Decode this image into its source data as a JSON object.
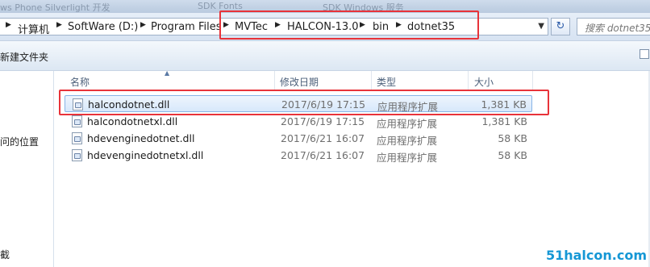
{
  "top_strip": {
    "blur_1": "ws Phone Silverlight 开发",
    "blur_2": "SDK Fonts",
    "blur_3": "SDK Windows 服务"
  },
  "address_bar": {
    "breadcrumbs": [
      "计算机",
      "SoftWare (D:)",
      "Program Files",
      "MVTec",
      "HALCON-13.0",
      "bin",
      "dotnet35"
    ]
  },
  "search": {
    "placeholder": "搜索 dotnet35"
  },
  "toolbar": {
    "new_folder_label": "新建文件夹"
  },
  "nav_pane": {
    "items": [
      "问的位置",
      "截"
    ]
  },
  "columns": {
    "name": "名称",
    "date": "修改日期",
    "type": "类型",
    "size": "大小"
  },
  "files": [
    {
      "name": "halcondotnet.dll",
      "date": "2017/6/19 17:15",
      "type": "应用程序扩展",
      "size": "1,381 KB",
      "selected": true
    },
    {
      "name": "halcondotnetxl.dll",
      "date": "2017/6/19 17:15",
      "type": "应用程序扩展",
      "size": "1,381 KB"
    },
    {
      "name": "hdevenginedotnet.dll",
      "date": "2017/6/21 16:07",
      "type": "应用程序扩展",
      "size": "58 KB"
    },
    {
      "name": "hdevenginedotnetxl.dll",
      "date": "2017/6/21 16:07",
      "type": "应用程序扩展",
      "size": "58 KB"
    }
  ],
  "watermark": "51halcon.com",
  "colors": {
    "highlight": "#e8333a",
    "selection": "#d7e8fb",
    "watermark": "#1597d5"
  }
}
